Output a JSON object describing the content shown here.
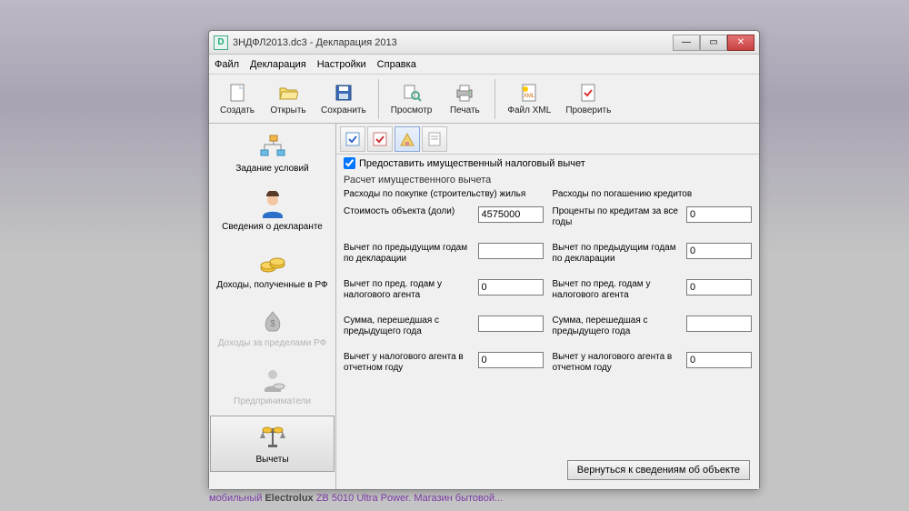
{
  "window": {
    "title": "3НДФЛ2013.dc3 - Декларация 2013"
  },
  "menu": {
    "file": "Файл",
    "declaration": "Декларация",
    "settings": "Настройки",
    "help": "Справка"
  },
  "toolbar": {
    "create": "Создать",
    "open": "Открыть",
    "save": "Сохранить",
    "preview": "Просмотр",
    "print": "Печать",
    "xml": "Файл XML",
    "check": "Проверить"
  },
  "sidebar": {
    "conditions": "Задание условий",
    "declarant": "Сведения о декларанте",
    "income_rf": "Доходы, полученные в РФ",
    "income_abroad": "Доходы за пределами РФ",
    "entrepreneur": "Предприниматели",
    "deductions": "Вычеты"
  },
  "main": {
    "grant_checkbox": "Предоставить имущественный налоговый вычет",
    "calc_label": "Расчет имущественного вычета",
    "left": {
      "title": "Расходы по покупке (строительству) жилья",
      "f1": {
        "label": "Стоимость объекта (доли)",
        "value": "4575000"
      },
      "f2": {
        "label": "Вычет по предыдущим годам по декларации",
        "value": ""
      },
      "f3": {
        "label": "Вычет по пред. годам у налогового агента",
        "value": "0"
      },
      "f4": {
        "label": "Сумма, перешедшая с предыдущего года",
        "value": ""
      },
      "f5": {
        "label": "Вычет у налогового агента в отчетном году",
        "value": "0"
      }
    },
    "right": {
      "title": "Расходы по погашению кредитов",
      "f1": {
        "label": "Проценты по кредитам за все годы",
        "value": "0"
      },
      "f2": {
        "label": "Вычет по предыдущим годам по декларации",
        "value": "0"
      },
      "f3": {
        "label": "Вычет по пред. годам у налогового агента",
        "value": "0"
      },
      "f4": {
        "label": "Сумма, перешедшая с предыдущего года",
        "value": ""
      },
      "f5": {
        "label": "Вычет у налогового агента в отчетном году",
        "value": "0"
      }
    },
    "back_button": "Вернуться к сведениям об объекте"
  },
  "footer": {
    "text_prefix": "мобильный ",
    "brand": "Electrolux",
    "text_suffix": " ZB 5010 Ultra Power. Магазин бытовой..."
  }
}
